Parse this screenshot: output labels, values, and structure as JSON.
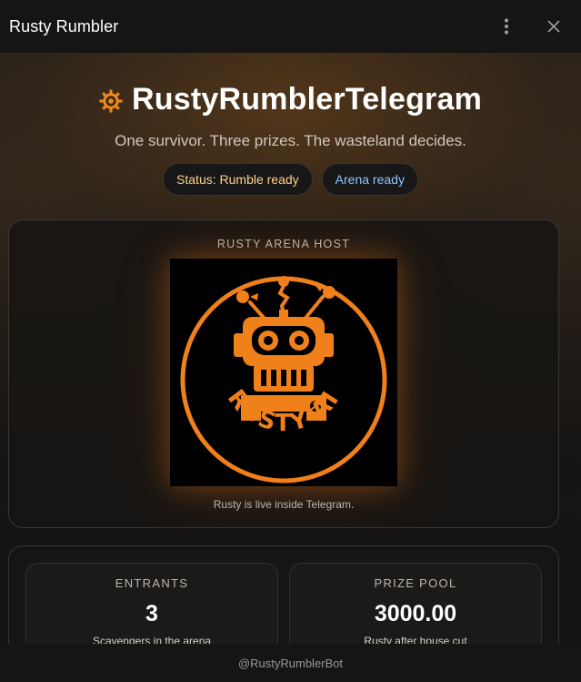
{
  "window": {
    "title": "Rusty Rumbler"
  },
  "hero": {
    "icon": "gear-icon",
    "accent_color": "#f08a1c",
    "title": "RustyRumblerTelegram",
    "subtitle": "One survivor. Three prizes. The wasteland decides."
  },
  "pills": {
    "status": "Status: Rumble ready",
    "arena": "Arena ready"
  },
  "host": {
    "label": "RUSTY ARENA HOST",
    "logo_text": "RUSTY AI",
    "caption": "Rusty is live inside Telegram."
  },
  "stats": {
    "entrants": {
      "label": "ENTRANTS",
      "value": "3",
      "sub": "Scavengers in the arena"
    },
    "prize_pool": {
      "label": "PRIZE POOL",
      "value": "3000.00",
      "sub": "Rusty after house cut"
    }
  },
  "footer": {
    "text": "@RustyRumblerBot"
  }
}
